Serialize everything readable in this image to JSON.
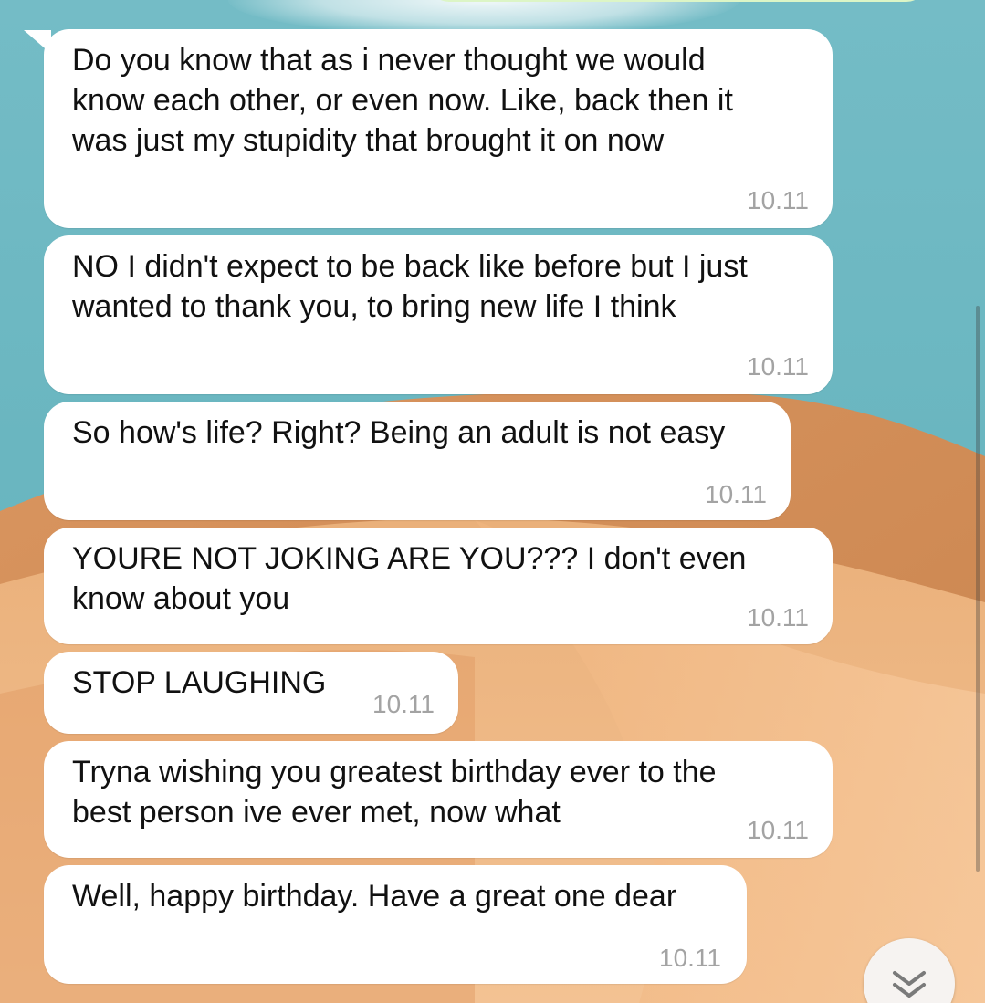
{
  "messages": [
    {
      "text": "Do you know that as i never thought we would\nknow each other, or even now. Like, back then it\nwas just my stupidity that brought it on now",
      "time": "10.11"
    },
    {
      "text": "NO I didn't expect to be back like before but I just\nwanted to thank you, to bring new life I think",
      "time": "10.11"
    },
    {
      "text": "So how's life? Right? Being an adult is not easy",
      "time": "10.11"
    },
    {
      "text": "YOURE NOT JOKING ARE YOU??? I don't even\nknow about you",
      "time": "10.11"
    },
    {
      "text": "STOP LAUGHING",
      "time": "10.11"
    },
    {
      "text": "Tryna wishing you greatest birthday ever to the\nbest person ive ever met, now what",
      "time": "10.11"
    },
    {
      "text": "Well, happy birthday. Have a great one dear",
      "time": "10.11"
    }
  ],
  "colors": {
    "sky": "#6ab6c0",
    "sand": "#e7a56c",
    "bubble": "#ffffff",
    "time_text": "#a3a3a3"
  },
  "scroll_down_button": {
    "icon": "double-chevron-down-icon"
  }
}
